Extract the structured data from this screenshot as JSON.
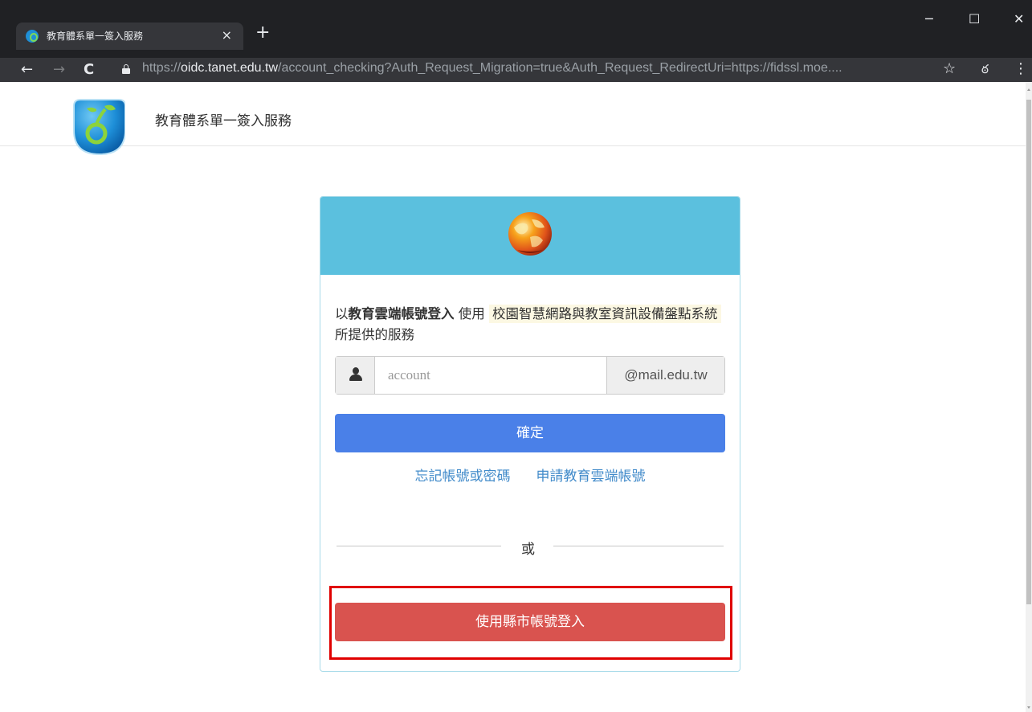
{
  "browser": {
    "tab_title": "教育體系單一簽入服務",
    "tab_close": "×",
    "new_tab": "+",
    "window_minimize": "─",
    "window_maximize": "☐",
    "window_close": "✕",
    "nav_back": "←",
    "nav_forward": "→",
    "nav_reload": "C",
    "url_scheme": "https://",
    "url_host": "oidc.tanet.edu.tw",
    "url_path": "/account_checking?Auth_Request_Migration=true&Auth_Request_RedirectUri=https://fidssl.moe....",
    "star": "☆",
    "incognito": "ఠ",
    "menu": "⋮"
  },
  "site": {
    "title": "教育體系單一簽入服務"
  },
  "login": {
    "intro_prefix": "以",
    "intro_strong": "教育雲端帳號登入",
    "intro_use": "使用",
    "service_name": "校園智慧網路與教室資訊設備盤點系統",
    "intro_suffix": "所提供的服務",
    "account_placeholder": "account",
    "account_value": "",
    "email_domain": "@mail.edu.tw",
    "confirm_label": "確定",
    "forgot_link": "忘記帳號或密碼",
    "apply_link": "申請教育雲端帳號",
    "or_text": "或",
    "county_login_label": "使用縣市帳號登入"
  },
  "colors": {
    "header_bar": "#5bc0de",
    "confirm_button": "#4a80e8",
    "county_button": "#d9534f",
    "highlight_box": "#e00000",
    "link": "#428bca"
  }
}
